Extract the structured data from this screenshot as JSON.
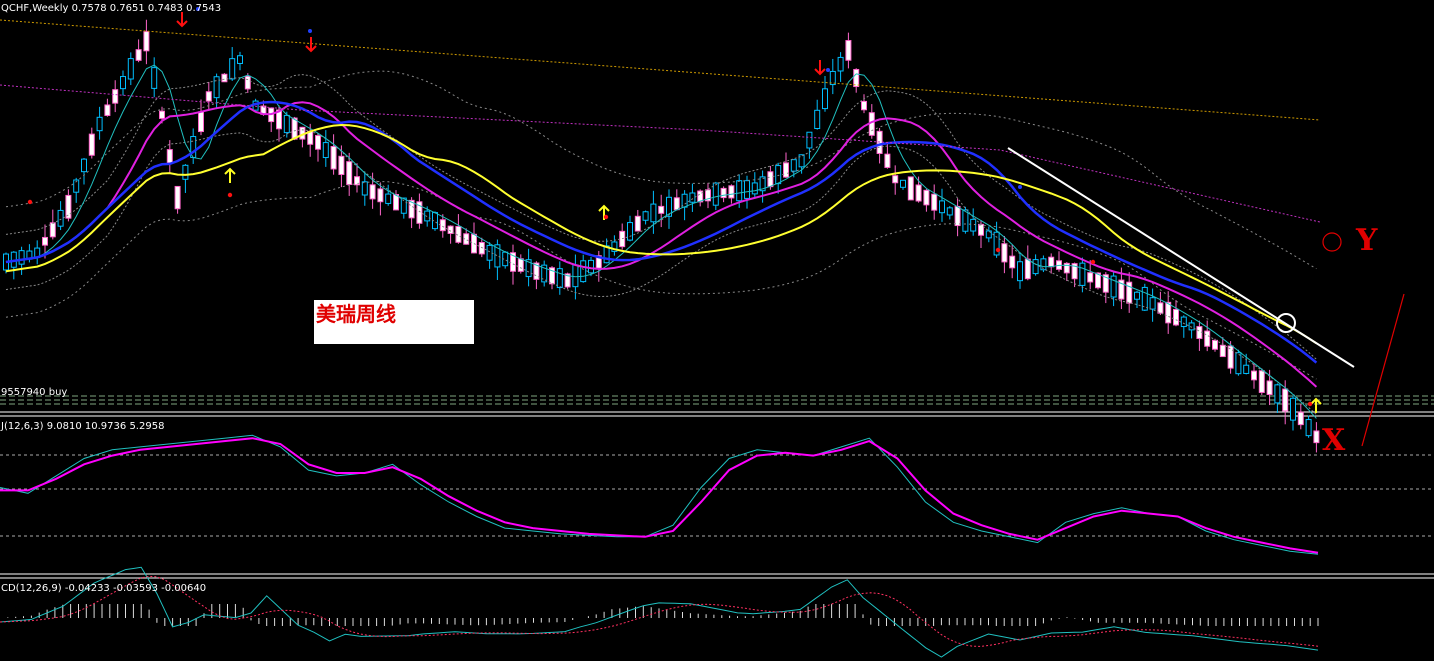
{
  "header": {
    "symbol_line": "QCHF,Weekly  0.7578 0.7651 0.7483 0.7543",
    "kdj_label": "J(12,6,3) 9.0810 10.9736 5.2958",
    "macd_label": "CD(12,26,9) -0.04233 -0.03593 -0.00640",
    "order_label": "9557940 buy"
  },
  "annotations": {
    "note": "美瑞周线",
    "y_mark": "Y",
    "x_mark": "X"
  },
  "colors": {
    "background": "#000000",
    "up_candle": "#00bfff",
    "down_candle": "#ff66cc",
    "ma_fast": "#e020e0",
    "ma_mid": "#2030ff",
    "ma_slow": "#ffff30",
    "band": "#888888",
    "ma_long_dotted": "#cc9900",
    "ma_long2_dotted": "#c030c0",
    "trendline": "#ffffff",
    "signal_red": "#ff1010",
    "signal_yellow": "#ffff20",
    "osc_k": "#20c0c0",
    "osc_d": "#ff00ff"
  },
  "chart_data": {
    "type": "candlestick",
    "timeframe": "Weekly",
    "ohlc_last": {
      "open": 0.7578,
      "high": 0.7651,
      "low": 0.7483,
      "close": 0.7543
    },
    "price_trend": [
      [
        0,
        0.3
      ],
      [
        4,
        0.32
      ],
      [
        8,
        0.42
      ],
      [
        12,
        0.6
      ],
      [
        16,
        0.72
      ],
      [
        18,
        0.78
      ],
      [
        20,
        0.62
      ],
      [
        22,
        0.44
      ],
      [
        26,
        0.66
      ],
      [
        30,
        0.74
      ],
      [
        32,
        0.64
      ],
      [
        36,
        0.6
      ],
      [
        40,
        0.56
      ],
      [
        46,
        0.46
      ],
      [
        54,
        0.4
      ],
      [
        62,
        0.32
      ],
      [
        68,
        0.28
      ],
      [
        72,
        0.26
      ],
      [
        76,
        0.3
      ],
      [
        82,
        0.4
      ],
      [
        88,
        0.44
      ],
      [
        96,
        0.46
      ],
      [
        102,
        0.52
      ],
      [
        106,
        0.7
      ],
      [
        108,
        0.76
      ],
      [
        110,
        0.64
      ],
      [
        114,
        0.48
      ],
      [
        120,
        0.42
      ],
      [
        126,
        0.36
      ],
      [
        130,
        0.28
      ],
      [
        134,
        0.3
      ],
      [
        140,
        0.26
      ],
      [
        146,
        0.22
      ],
      [
        152,
        0.16
      ],
      [
        158,
        0.08
      ],
      [
        164,
        0.0
      ],
      [
        168,
        -0.08
      ]
    ],
    "kdj": {
      "label": "J(12,6,3) 9.0810 10.9736 5.2958",
      "k": [
        50,
        46,
        58,
        70,
        76,
        78,
        80,
        82,
        84,
        86,
        78,
        62,
        58,
        60,
        66,
        52,
        40,
        30,
        22,
        20,
        18,
        17,
        16,
        16,
        24,
        50,
        70,
        76,
        74,
        72,
        78,
        84,
        64,
        40,
        26,
        20,
        16,
        12,
        26,
        32,
        36,
        32,
        30,
        20,
        14,
        10,
        6,
        4
      ],
      "d": [
        48,
        48,
        56,
        66,
        72,
        76,
        78,
        80,
        82,
        84,
        80,
        66,
        60,
        60,
        64,
        56,
        44,
        34,
        26,
        22,
        20,
        18,
        17,
        16,
        20,
        40,
        62,
        72,
        74,
        72,
        76,
        82,
        70,
        48,
        32,
        24,
        18,
        14,
        22,
        30,
        34,
        32,
        30,
        22,
        16,
        12,
        8,
        5
      ]
    },
    "macd": {
      "label": "CD(12,26,9) -0.04233 -0.03593 -0.00640",
      "macd": [
        -0.0423
      ],
      "signal": [
        -0.0359
      ],
      "histogram": [
        -0.0064
      ]
    }
  }
}
